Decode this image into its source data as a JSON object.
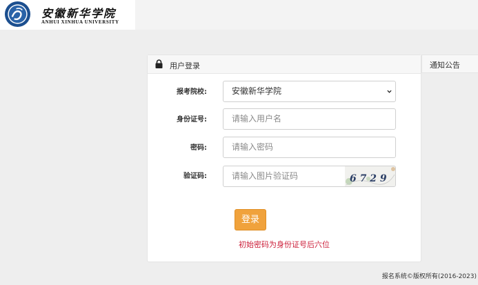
{
  "header": {
    "logo_cn": "安徽新华学院",
    "logo_en": "ANHUI XINHUA UNIVERSITY"
  },
  "login": {
    "title": "用户登录",
    "school_label": "报考院校:",
    "school_value": "安徽新华学院",
    "id_label": "身份证号:",
    "id_placeholder": "请输入用户名",
    "password_label": "密码:",
    "password_placeholder": "请输入密码",
    "captcha_label": "验证码:",
    "captcha_placeholder": "请输入图片验证码",
    "captcha_text": "6 7 2 9",
    "login_button": "登录",
    "notice": "初始密码为身份证号后六位"
  },
  "notice_panel": {
    "title": "通知公告"
  },
  "footer": {
    "copyright": "报名系统©版权所有(2016-2023)"
  },
  "colors": {
    "accent": "#f0a23c",
    "notice": "#cc1f3a",
    "background": "#eeeeee"
  },
  "icons": {
    "logo": "university-seal-icon",
    "lock": "lock-icon",
    "dropdown": "chevron-down-icon"
  }
}
